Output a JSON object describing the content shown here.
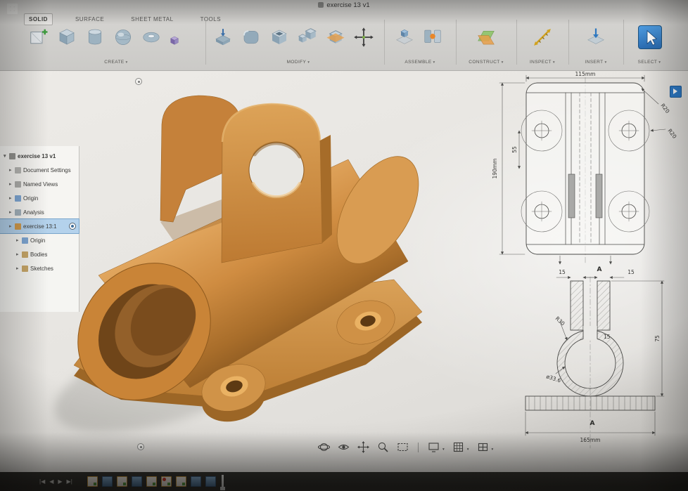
{
  "app": {
    "title": "exercise 13 v1"
  },
  "tabs": [
    {
      "label": "SOLID"
    },
    {
      "label": "SURFACE"
    },
    {
      "label": "SHEET METAL"
    },
    {
      "label": "TOOLS"
    }
  ],
  "groups": [
    {
      "label": "CREATE"
    },
    {
      "label": "MODIFY"
    },
    {
      "label": "ASSEMBLE"
    },
    {
      "label": "CONSTRUCT"
    },
    {
      "label": "INSPECT"
    },
    {
      "label": "INSERT"
    },
    {
      "label": "SELECT"
    }
  ],
  "browser": {
    "items": [
      {
        "label": "exercise 13 v1",
        "cls": "b-row root"
      },
      {
        "label": "Document Settings",
        "cls": "b-row i1"
      },
      {
        "label": "Named Views",
        "cls": "b-row i1"
      },
      {
        "label": "Origin",
        "cls": "b-row i1"
      },
      {
        "label": "Analysis",
        "cls": "b-row i1"
      },
      {
        "label": "exercise 13:1",
        "cls": "b-row i1 selected"
      },
      {
        "label": "Origin",
        "cls": "b-row i2"
      },
      {
        "label": "Bodies",
        "cls": "b-row i2"
      },
      {
        "label": "Sketches",
        "cls": "b-row i2"
      }
    ]
  },
  "drawing": {
    "front": {
      "width": "115mm",
      "height": "190mm",
      "inner": "55",
      "r_top": "R20",
      "r_side": "R20",
      "section": "A"
    },
    "section": {
      "leg_left": "15",
      "leg_right": "15",
      "slot": "15",
      "radius": "R30",
      "bore": "ø33.6",
      "height": "75",
      "width": "165mm",
      "label": "A"
    }
  },
  "model": {
    "color": "#cd8a3f",
    "canvas": "#e8e7e3"
  },
  "nav_icons": [
    "orbit",
    "look-at",
    "pan",
    "zoom",
    "fit",
    "display-settings",
    "layout-grid",
    "viewports"
  ],
  "timeline": {
    "features": [
      {
        "cls": "tl-feat sketch"
      },
      {
        "cls": "tl-feat extrude"
      },
      {
        "cls": "tl-feat sketch"
      },
      {
        "cls": "tl-feat extrude"
      },
      {
        "cls": "tl-feat sketch"
      },
      {
        "cls": "tl-feat sketch warn"
      },
      {
        "cls": "tl-feat sketch"
      },
      {
        "cls": "tl-feat extrude"
      },
      {
        "cls": "tl-feat extrude"
      }
    ]
  }
}
